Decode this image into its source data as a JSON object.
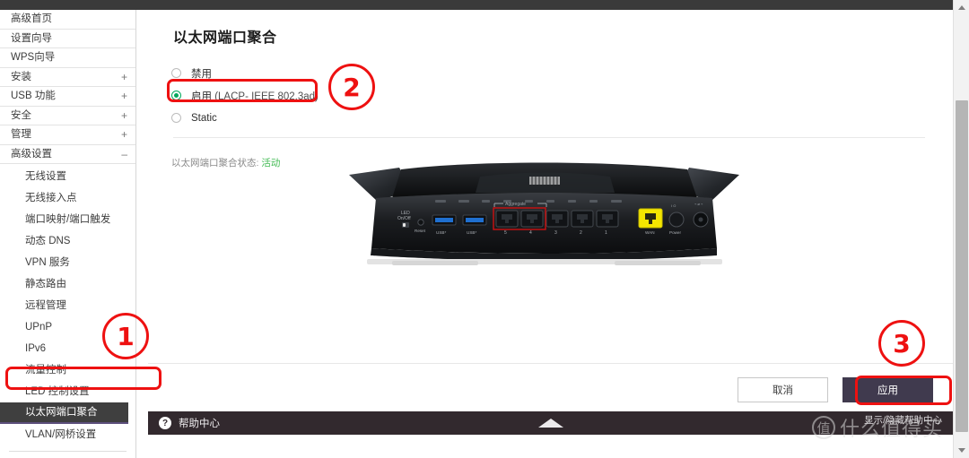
{
  "page": {
    "title": "以太网端口聚合"
  },
  "sidebar": {
    "top_items": [
      {
        "label": "高级首页",
        "expander": ""
      },
      {
        "label": "设置向导",
        "expander": ""
      },
      {
        "label": "WPS向导",
        "expander": ""
      },
      {
        "label": "安装",
        "expander": "+"
      },
      {
        "label": "USB 功能",
        "expander": "+"
      },
      {
        "label": "安全",
        "expander": "+"
      },
      {
        "label": "管理",
        "expander": "+"
      },
      {
        "label": "高级设置",
        "expander": "–"
      }
    ],
    "sub_items": [
      {
        "label": "无线设置",
        "selected": false
      },
      {
        "label": "无线接入点",
        "selected": false
      },
      {
        "label": "端口映射/端口触发",
        "selected": false
      },
      {
        "label": "动态 DNS",
        "selected": false
      },
      {
        "label": "VPN 服务",
        "selected": false
      },
      {
        "label": "静态路由",
        "selected": false
      },
      {
        "label": "远程管理",
        "selected": false
      },
      {
        "label": "UPnP",
        "selected": false
      },
      {
        "label": "IPv6",
        "selected": false
      },
      {
        "label": "流量控制",
        "selected": false
      },
      {
        "label": "LED 控制设置",
        "selected": false
      },
      {
        "label": "以太网端口聚合",
        "selected": true
      },
      {
        "label": "VLAN/网桥设置",
        "selected": false
      }
    ]
  },
  "options": [
    {
      "label": "禁用",
      "note": "",
      "checked": false
    },
    {
      "label": "启用",
      "note": " (LACP- IEEE 802.3ad)",
      "checked": true
    },
    {
      "label": "Static",
      "note": "",
      "checked": false
    }
  ],
  "status": {
    "label": "以太网端口聚合状态:",
    "value": "活动"
  },
  "router_image": {
    "caption_aggregate": "Aggregate",
    "led_label_1": "LED",
    "led_label_2": "On/Off",
    "reset_label": "Reset",
    "usb_labels": [
      "USB*",
      "USB*"
    ],
    "port_labels": [
      "5",
      "4",
      "3",
      "2",
      "1"
    ],
    "wan_label": "WAN",
    "power_label": "Power"
  },
  "buttons": {
    "cancel": "取消",
    "apply": "应用"
  },
  "helpbar": {
    "icon": "?",
    "title": "帮助中心",
    "toggle": "显示/隐藏帮助中心"
  },
  "annotations": [
    {
      "id": "1",
      "target": "sidebar-item-ethernet-aggregation"
    },
    {
      "id": "2",
      "target": "radio-option-enable"
    },
    {
      "id": "3",
      "target": "apply-button"
    }
  ],
  "watermark": {
    "badge": "值",
    "text": "什么值得买"
  },
  "colors": {
    "accent_green": "#00a95c",
    "status_green": "#3fb950",
    "apply_bg": "#403a4e",
    "annotation_red": "#ee1111",
    "selected_nav_bg": "#3f3f3f"
  }
}
